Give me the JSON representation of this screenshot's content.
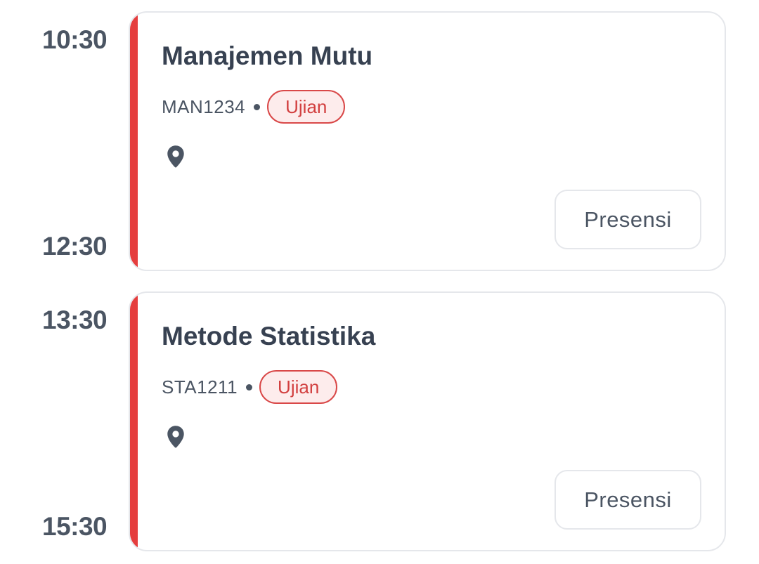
{
  "schedule": [
    {
      "start_time": "10:30",
      "end_time": "12:30",
      "title": "Manajemen Mutu",
      "code": "MAN1234",
      "type_badge": "Ujian",
      "action_label": "Presensi"
    },
    {
      "start_time": "13:30",
      "end_time": "15:30",
      "title": "Metode Statistika",
      "code": "STA1211",
      "type_badge": "Ujian",
      "action_label": "Presensi"
    }
  ],
  "icons": {
    "location": "location-pin-icon"
  },
  "colors": {
    "accent_red": "#e53e3e",
    "badge_border": "#d94848",
    "badge_background": "#fdecec",
    "text_primary": "#374151",
    "text_secondary": "#4b5563",
    "card_border": "#e5e7eb"
  }
}
